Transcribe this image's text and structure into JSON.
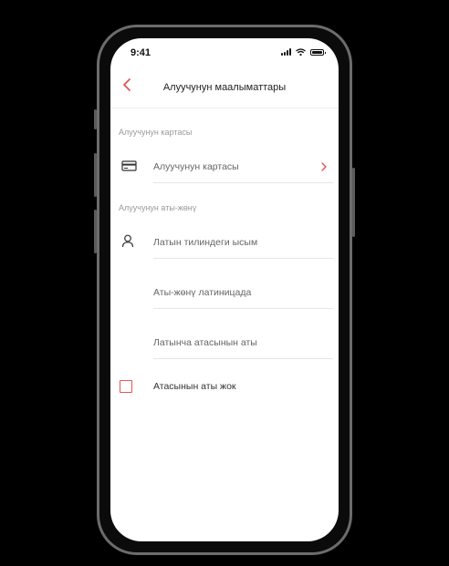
{
  "status": {
    "time": "9:41"
  },
  "nav": {
    "title": "Алуучунун маалыматтары"
  },
  "sections": {
    "card": "Алуучунун картасы",
    "name": "Алуучунун аты-жөнү"
  },
  "card_row": {
    "label": "Алуучунун картасы"
  },
  "fields": {
    "first_name": "Латын тилиндеги ысым",
    "last_name": "Аты-жөнү латиницада",
    "patronymic": "Латынча атасынын аты"
  },
  "no_patronymic": {
    "label": "Атасынын аты жок",
    "checked": false
  },
  "colors": {
    "accent": "#e55353"
  }
}
